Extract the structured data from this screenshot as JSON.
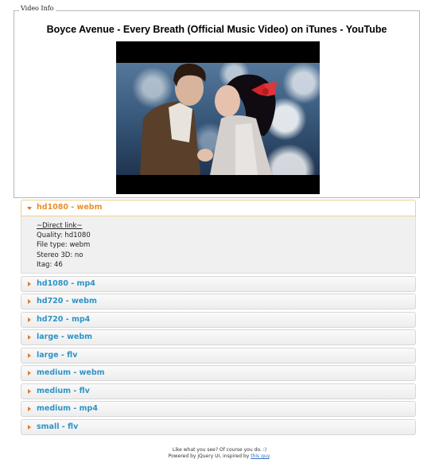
{
  "video_info": {
    "legend": "Video Info",
    "title": "Boyce Avenue - Every Breath (Official Music Video) on iTunes - YouTube"
  },
  "formats": {
    "active": {
      "label": "hd1080 - webm",
      "direct_link": "~Direct link~",
      "quality": "Quality: hd1080",
      "file_type": "File type: webm",
      "stereo_3d": "Stereo 3D: no",
      "itag": "Itag: 46"
    },
    "items": [
      {
        "label": "hd1080 - mp4"
      },
      {
        "label": "hd720 - webm"
      },
      {
        "label": "hd720 - mp4"
      },
      {
        "label": "large - webm"
      },
      {
        "label": "large - flv"
      },
      {
        "label": "medium - webm"
      },
      {
        "label": "medium - flv"
      },
      {
        "label": "medium - mp4"
      },
      {
        "label": "small - flv"
      }
    ]
  },
  "footer": {
    "line1": "Like what you see? Of course you do. :)",
    "line2_prefix": "Powered by jQuery UI, inspired by ",
    "link": "this guy",
    "line2_suffix": "."
  },
  "colors": {
    "active_label": "#e8902e",
    "label": "#2f93c5",
    "arrow": "#e07b2e"
  }
}
